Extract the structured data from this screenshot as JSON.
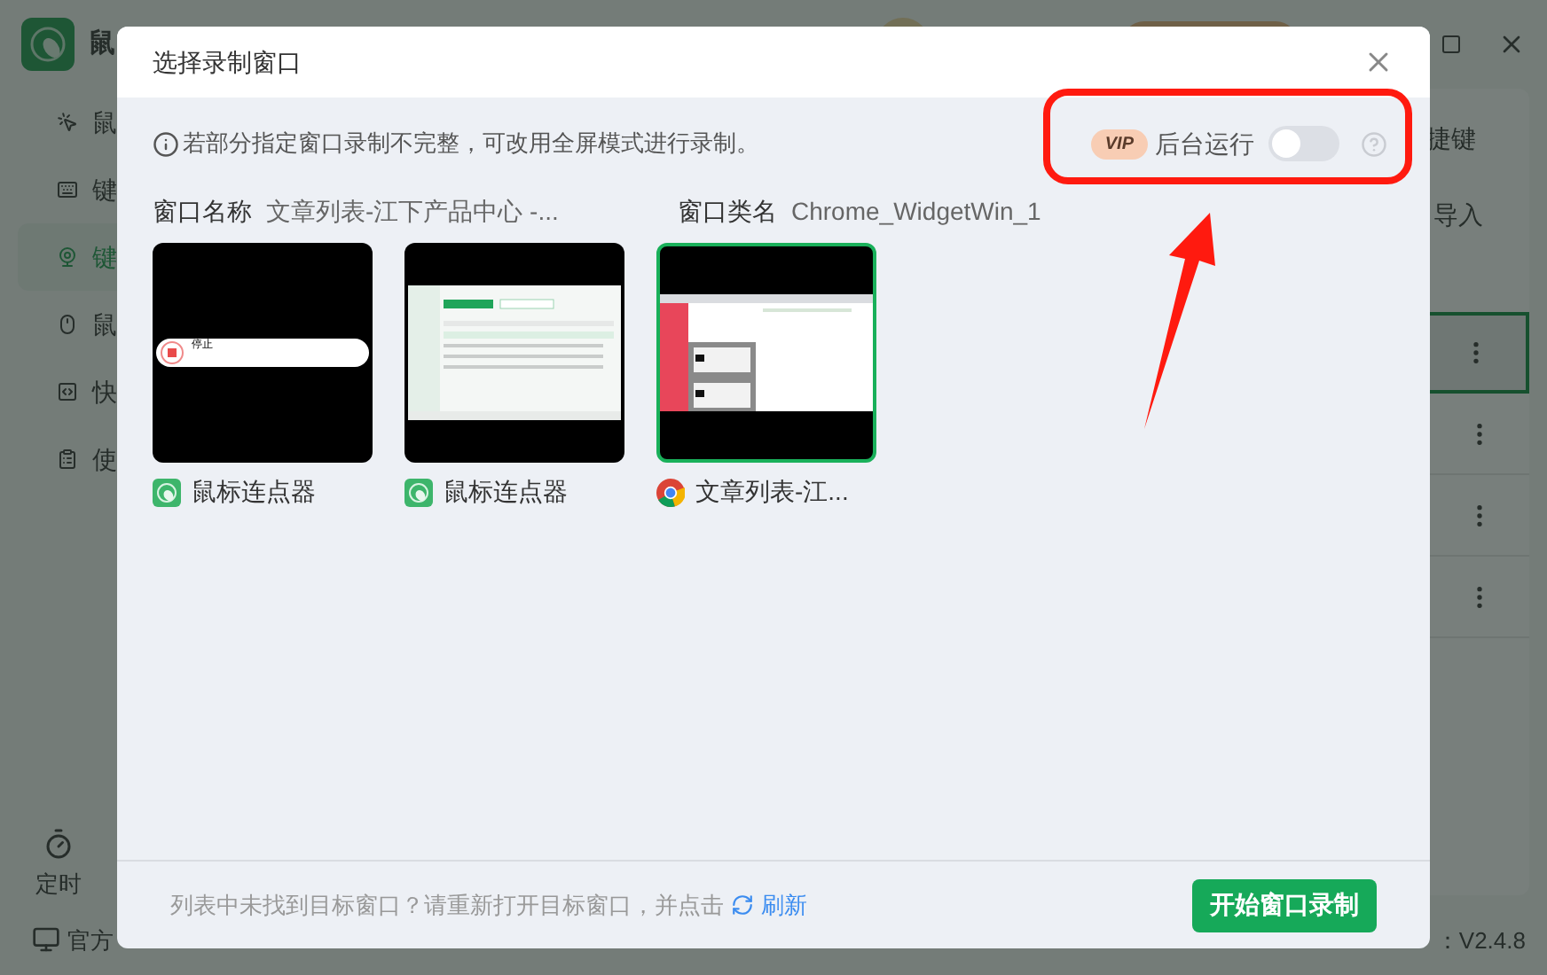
{
  "background": {
    "app_title": "鼠",
    "sidebar": [
      {
        "label": "鼠",
        "selected": false
      },
      {
        "label": "键",
        "selected": false
      },
      {
        "label": "键",
        "selected": true
      },
      {
        "label": "鼠",
        "selected": false
      },
      {
        "label": "快",
        "selected": false
      },
      {
        "label": "使",
        "selected": false
      }
    ],
    "timer": "定时",
    "footer_link": "官方",
    "version": "：V2.4.8",
    "panel": {
      "shortcut": "捷键",
      "import": "导入",
      "rows": [
        {
          "selected": true
        },
        {
          "selected": false
        },
        {
          "selected": false
        },
        {
          "selected": false
        }
      ]
    }
  },
  "dialog": {
    "title": "选择录制窗口",
    "notice": "若部分指定窗口录制不完整，可改用全屏模式进行录制。",
    "vip": "VIP",
    "background_run": {
      "label": "后台运行",
      "on": false
    },
    "window_name": {
      "label": "窗口名称",
      "value": "文章列表-江下产品中心 -..."
    },
    "window_class": {
      "label": "窗口类名",
      "value": "Chrome_WidgetWin_1"
    },
    "windows": [
      {
        "kind": "recorder-bar",
        "thumb_text": "停止",
        "name": "鼠标连点器",
        "selected": false
      },
      {
        "kind": "app-window",
        "name": "鼠标连点器",
        "selected": false
      },
      {
        "kind": "browser-window",
        "name": "文章列表-江...",
        "selected": true
      }
    ],
    "footer_text": "列表中未找到目标窗口？请重新打开目标窗口，并点击",
    "refresh": "刷新",
    "start": "开始窗口录制"
  }
}
